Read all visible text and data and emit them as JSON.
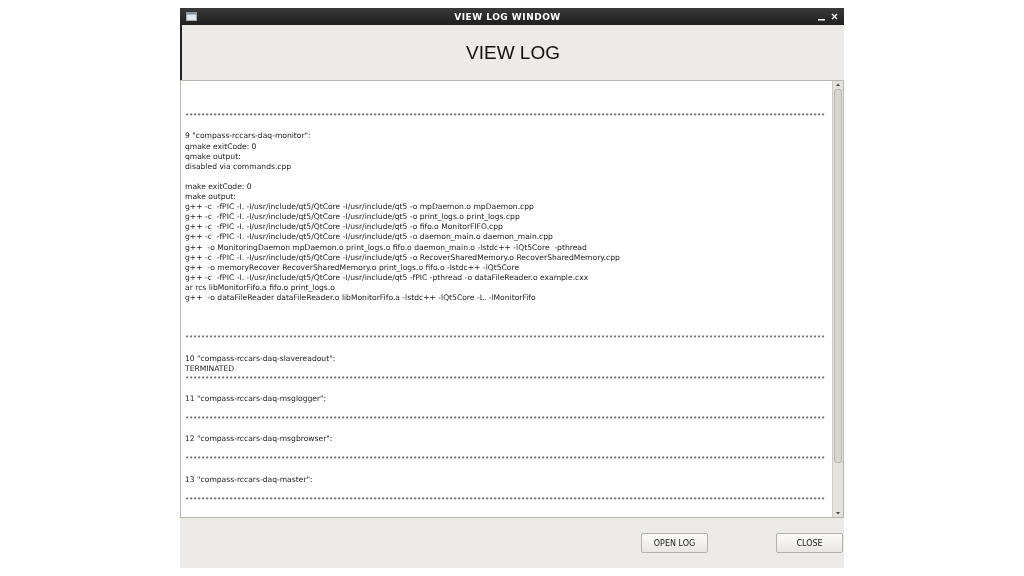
{
  "window": {
    "title": "VIEW LOG WINDOW"
  },
  "header": {
    "title": "VIEW LOG"
  },
  "log": {
    "lines": [
      {
        "kind": "blank"
      },
      {
        "kind": "blank"
      },
      {
        "kind": "blank"
      },
      {
        "kind": "separator",
        "text": "****************************************************************************************************************************************************************"
      },
      {
        "kind": "blank"
      },
      {
        "kind": "text",
        "text": "9 \"compass-rccars-daq-monitor\":"
      },
      {
        "kind": "text",
        "text": "qmake exitCode: 0"
      },
      {
        "kind": "text",
        "text": "qmake output:"
      },
      {
        "kind": "text",
        "text": "disabled via commands.cpp"
      },
      {
        "kind": "blank"
      },
      {
        "kind": "text",
        "text": "make exitCode: 0"
      },
      {
        "kind": "text",
        "text": "make output:"
      },
      {
        "kind": "text",
        "text": "g++ -c  -fPIC -I. -I/usr/include/qt5/QtCore -I/usr/include/qt5 -o mpDaemon.o mpDaemon.cpp"
      },
      {
        "kind": "text",
        "text": "g++ -c  -fPIC -I. -I/usr/include/qt5/QtCore -I/usr/include/qt5 -o print_logs.o print_logs.cpp"
      },
      {
        "kind": "text",
        "text": "g++ -c  -fPIC -I. -I/usr/include/qt5/QtCore -I/usr/include/qt5 -o fifo.o MonitorFIFO.cpp"
      },
      {
        "kind": "text",
        "text": "g++ -c  -fPIC -I. -I/usr/include/qt5/QtCore -I/usr/include/qt5 -o daemon_main.o daemon_main.cpp"
      },
      {
        "kind": "text",
        "text": "g++  -o MonitoringDaemon mpDaemon.o print_logs.o fifo.o daemon_main.o -lstdc++ -lQt5Core  -pthread"
      },
      {
        "kind": "text",
        "text": "g++ -c  -fPIC -I. -I/usr/include/qt5/QtCore -I/usr/include/qt5 -o RecoverSharedMemory.o RecoverSharedMemory.cpp"
      },
      {
        "kind": "text",
        "text": "g++  -o memoryRecover RecoverSharedMemory.o print_logs.o fifo.o -lstdc++ -lQt5Core"
      },
      {
        "kind": "text",
        "text": "g++ -c  -fPIC -I. -I/usr/include/qt5/QtCore -I/usr/include/qt5 -fPIC -pthread -o dataFileReader.o example.cxx"
      },
      {
        "kind": "text",
        "text": "ar rcs libMonitorFifo.a fifo.o print_logs.o"
      },
      {
        "kind": "text",
        "text": "g++  -o dataFileReader dataFileReader.o libMonitorFifo.a -lstdc++ -lQt5Core -L. -lMonitorFifo"
      },
      {
        "kind": "blank"
      },
      {
        "kind": "blank"
      },
      {
        "kind": "blank"
      },
      {
        "kind": "separator",
        "text": "****************************************************************************************************************************************************************"
      },
      {
        "kind": "blank"
      },
      {
        "kind": "text",
        "text": "10 \"compass-rccars-daq-slavereadout\":"
      },
      {
        "kind": "text",
        "text": "TERMINATED"
      },
      {
        "kind": "separator",
        "text": "****************************************************************************************************************************************************************"
      },
      {
        "kind": "blank"
      },
      {
        "kind": "text",
        "text": "11 \"compass-rccars-daq-msglogger\":"
      },
      {
        "kind": "blank"
      },
      {
        "kind": "separator",
        "text": "****************************************************************************************************************************************************************"
      },
      {
        "kind": "blank"
      },
      {
        "kind": "text",
        "text": "12 \"compass-rccars-daq-msgbrowser\":"
      },
      {
        "kind": "blank"
      },
      {
        "kind": "separator",
        "text": "****************************************************************************************************************************************************************"
      },
      {
        "kind": "blank"
      },
      {
        "kind": "text",
        "text": "13 \"compass-rccars-daq-master\":"
      },
      {
        "kind": "blank"
      },
      {
        "kind": "separator",
        "text": "****************************************************************************************************************************************************************"
      }
    ]
  },
  "buttons": [
    {
      "label": "OPEN LOG"
    },
    {
      "label": "CLOSE"
    }
  ]
}
